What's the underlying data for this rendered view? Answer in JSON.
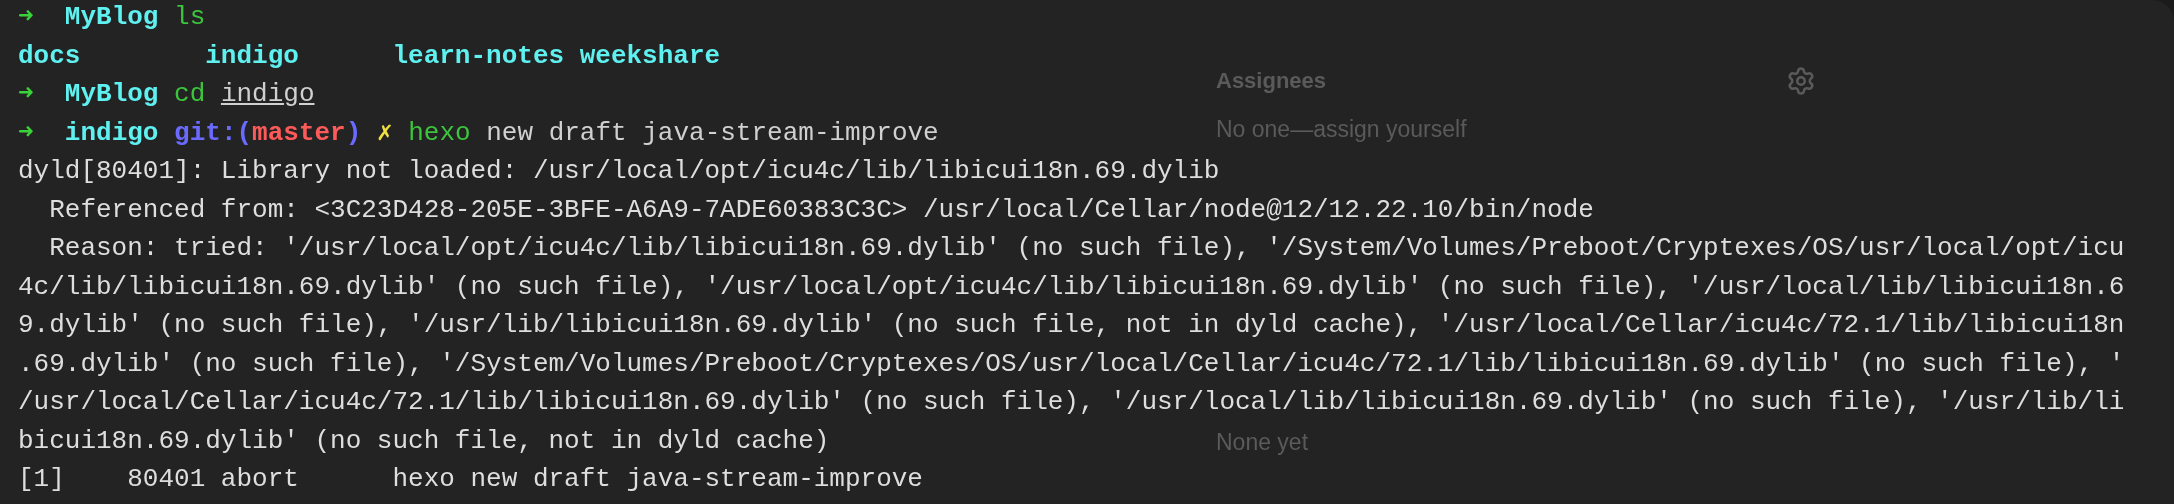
{
  "background_page": {
    "sidebar": [
      {
        "title": "Assignees",
        "value": "No one—assign yourself",
        "has_gear": true
      },
      {
        "value": "None yet",
        "has_gear": false
      }
    ]
  },
  "terminal": {
    "lines": [
      {
        "segments": [
          {
            "kind": "arrow",
            "text": "➜  "
          },
          {
            "kind": "dir",
            "text": "MyBlog "
          },
          {
            "kind": "cmd",
            "text": "ls"
          }
        ]
      },
      {
        "segments": [
          {
            "kind": "listing",
            "text": "docs        indigo      learn-notes weekshare"
          }
        ]
      },
      {
        "segments": [
          {
            "kind": "arrow",
            "text": "➜  "
          },
          {
            "kind": "dir",
            "text": "MyBlog "
          },
          {
            "kind": "cmd",
            "text": "cd "
          },
          {
            "kind": "path",
            "text": "indigo"
          }
        ]
      },
      {
        "segments": [
          {
            "kind": "arrow",
            "text": "➜  "
          },
          {
            "kind": "dir",
            "text": "indigo "
          },
          {
            "kind": "git",
            "text": "git:("
          },
          {
            "kind": "branch",
            "text": "master"
          },
          {
            "kind": "git",
            "text": ") "
          },
          {
            "kind": "dirty",
            "text": "✗ "
          },
          {
            "kind": "cmd",
            "text": "hexo"
          },
          {
            "kind": "arg",
            "text": " new draft java-stream-improve"
          }
        ]
      },
      {
        "segments": [
          {
            "kind": "output",
            "text": "dyld[80401]: Library not loaded: /usr/local/opt/icu4c/lib/libicui18n.69.dylib"
          }
        ]
      },
      {
        "segments": [
          {
            "kind": "output",
            "text": "  Referenced from: <3C23D428-205E-3BFE-A6A9-7ADE60383C3C> /usr/local/Cellar/node@12/12.22.10/bin/node"
          }
        ]
      },
      {
        "segments": [
          {
            "kind": "output",
            "text": "  Reason: tried: '/usr/local/opt/icu4c/lib/libicui18n.69.dylib' (no such file), '/System/Volumes/Preboot/Cryptexes/OS/usr/local/opt/icu"
          }
        ]
      },
      {
        "segments": [
          {
            "kind": "output",
            "text": "4c/lib/libicui18n.69.dylib' (no such file), '/usr/local/opt/icu4c/lib/libicui18n.69.dylib' (no such file), '/usr/local/lib/libicui18n.6"
          }
        ]
      },
      {
        "segments": [
          {
            "kind": "output",
            "text": "9.dylib' (no such file), '/usr/lib/libicui18n.69.dylib' (no such file, not in dyld cache), '/usr/local/Cellar/icu4c/72.1/lib/libicui18n"
          }
        ]
      },
      {
        "segments": [
          {
            "kind": "output",
            "text": ".69.dylib' (no such file), '/System/Volumes/Preboot/Cryptexes/OS/usr/local/Cellar/icu4c/72.1/lib/libicui18n.69.dylib' (no such file), '"
          }
        ]
      },
      {
        "segments": [
          {
            "kind": "output",
            "text": "/usr/local/Cellar/icu4c/72.1/lib/libicui18n.69.dylib' (no such file), '/usr/local/lib/libicui18n.69.dylib' (no such file), '/usr/lib/li"
          }
        ]
      },
      {
        "segments": [
          {
            "kind": "output",
            "text": "bicui18n.69.dylib' (no such file, not in dyld cache)"
          }
        ]
      },
      {
        "segments": [
          {
            "kind": "output",
            "text": "[1]    80401 abort      hexo new draft java-stream-improve"
          }
        ]
      }
    ]
  }
}
